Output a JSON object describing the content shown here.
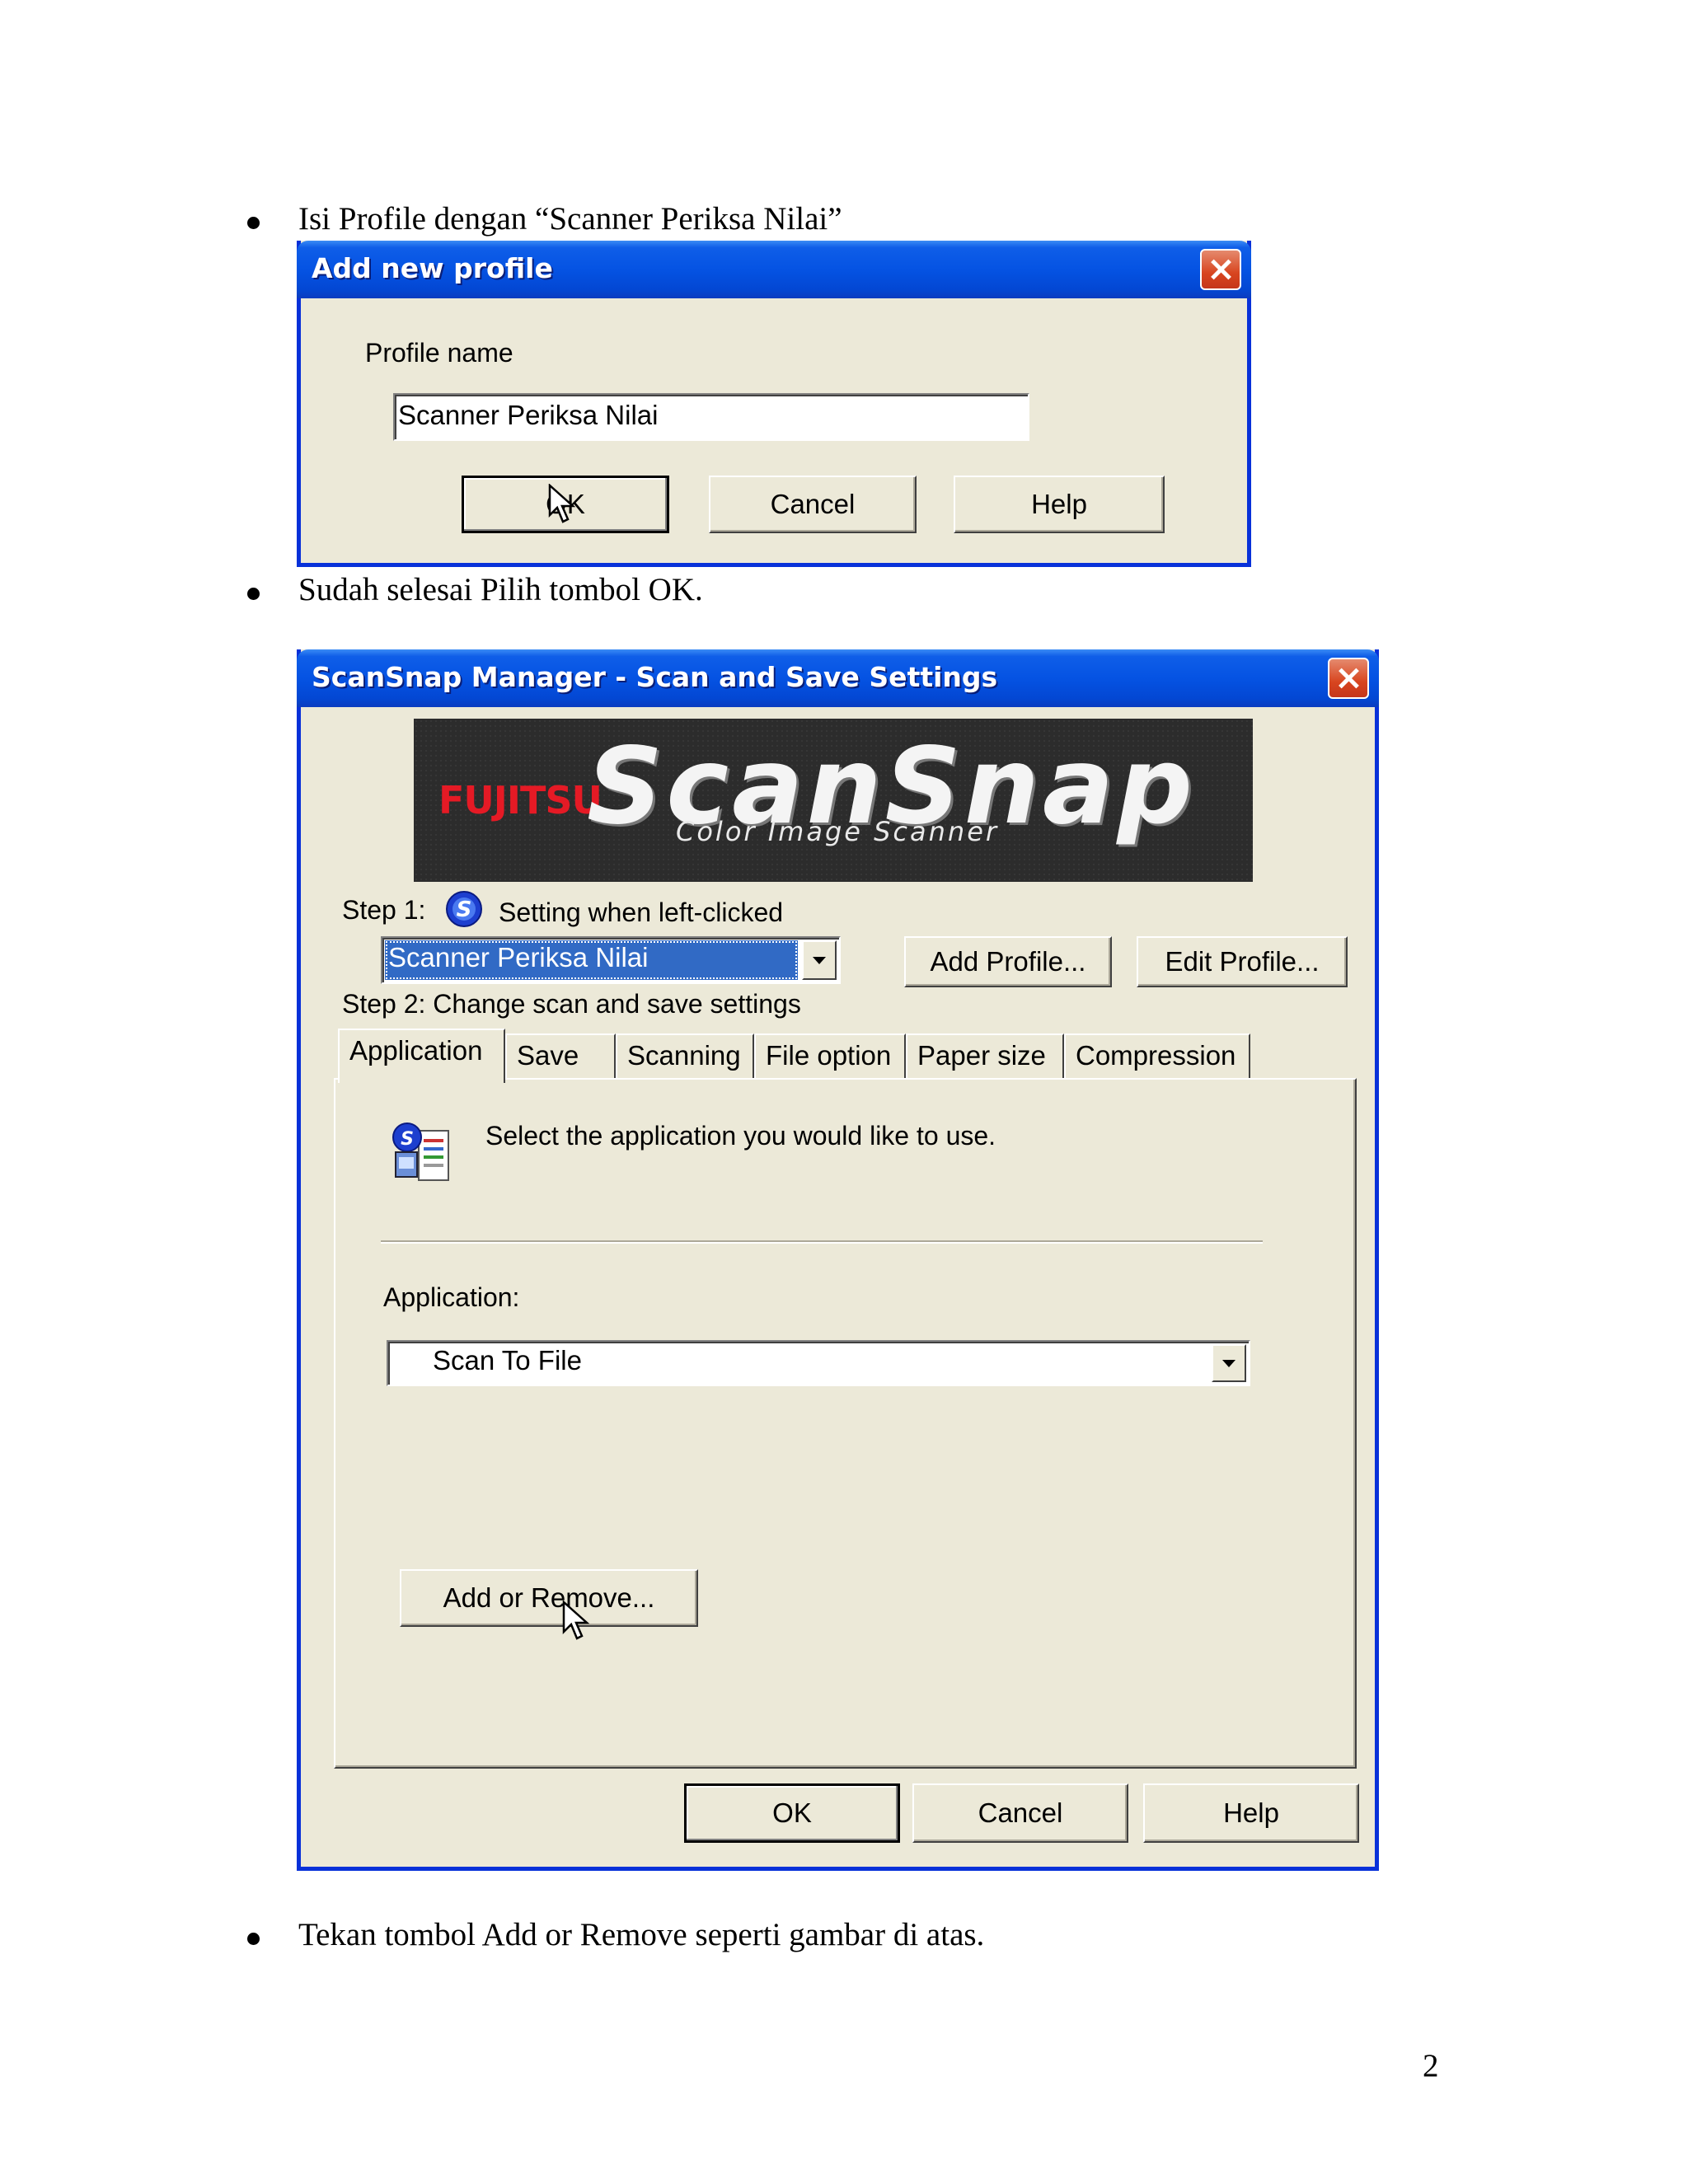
{
  "bullets": [
    "Isi Profile dengan “Scanner Periksa Nilai”",
    "Sudah selesai Pilih tombol OK.",
    "Tekan tombol Add or Remove seperti gambar di atas."
  ],
  "page_number": "2",
  "dialog_add_profile": {
    "title": "Add new profile",
    "profile_name_label": "Profile name",
    "profile_name_value": "Scanner Periksa Nilai",
    "ok_label": "OK",
    "cancel_label": "Cancel",
    "help_label": "Help"
  },
  "dialog_scansnap": {
    "title": "ScanSnap Manager - Scan and Save Settings",
    "banner": {
      "brand": "FUJITSU",
      "product": "ScanSnap",
      "tagline": "Color Image Scanner"
    },
    "step1_label": "Step 1:",
    "step1_text": "Setting when left-clicked",
    "profile_selected": "Scanner Periksa Nilai",
    "add_profile_label": "Add Profile...",
    "edit_profile_label": "Edit Profile...",
    "step2_label": "Step 2: Change scan and save settings",
    "tabs": [
      "Application",
      "Save",
      "Scanning",
      "File option",
      "Paper size",
      "Compression"
    ],
    "instruction": "Select the application you would like to use.",
    "application_label": "Application:",
    "application_value": "Scan To File",
    "add_remove_label": "Add or Remove...",
    "ok_label": "OK",
    "cancel_label": "Cancel",
    "help_label": "Help"
  },
  "colors": {
    "titlebar_blue": "#0553e3",
    "window_face": "#ece9d8",
    "selection_blue": "#316ac5",
    "close_red": "#d8451f"
  }
}
